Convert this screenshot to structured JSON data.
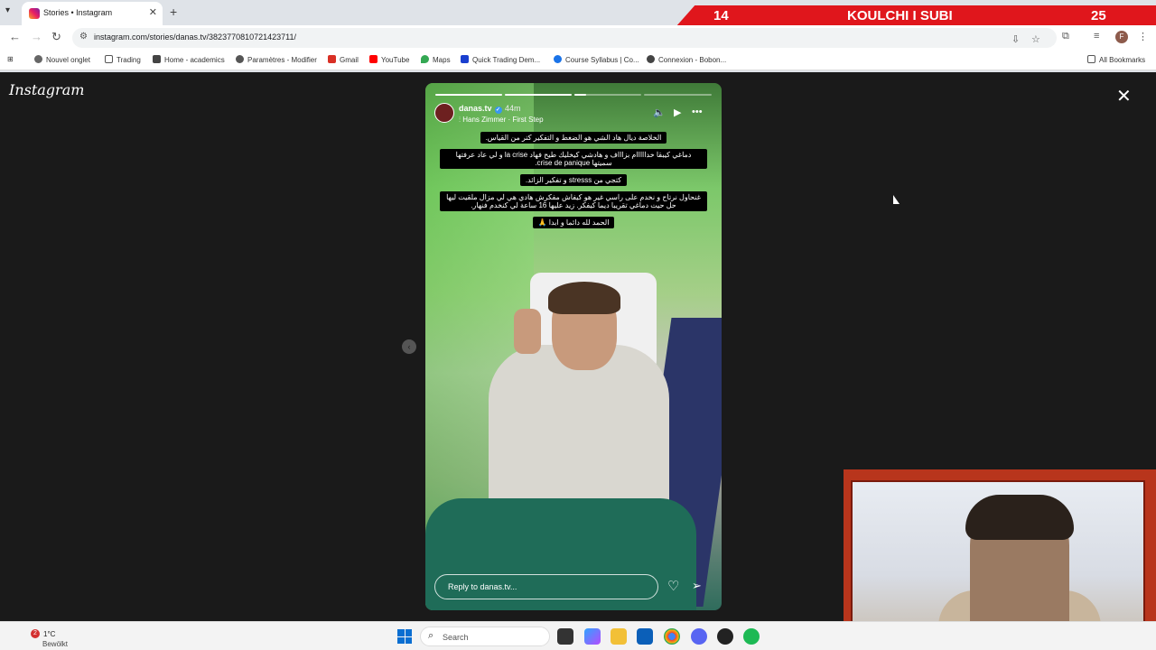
{
  "browser": {
    "tab_title": "Stories • Instagram",
    "tab_close": "✕",
    "new_tab": "+",
    "url": "instagram.com/stories/danas.tv/3823770810721423711/",
    "bookmarks": [
      {
        "label": "Nouvel onglet",
        "color": "#555"
      },
      {
        "label": "Trading",
        "color": "#777"
      },
      {
        "label": "Home - academics",
        "color": "#444"
      },
      {
        "label": "Paramètres - Modifier",
        "color": "#555"
      },
      {
        "label": "Gmail",
        "color": "#d93025"
      },
      {
        "label": "YouTube",
        "color": "#ff0000"
      },
      {
        "label": "Maps",
        "color": "#34a853"
      },
      {
        "label": "Quick Trading Dem...",
        "color": "#1a3fcf"
      },
      {
        "label": "Course Syllabus | Co...",
        "color": "#1a73e8"
      },
      {
        "label": "Connexion - Bobon...",
        "color": "#444"
      }
    ],
    "all_bookmarks": "All Bookmarks",
    "profile_initial": "F"
  },
  "overlay_banner": {
    "left_number": "14",
    "text": "KOULCHI I SUBI",
    "right_number": "25"
  },
  "instagram": {
    "logo": "Instagram",
    "close": "✕",
    "prev": "‹"
  },
  "story": {
    "username": "danas.tv",
    "verified": "✓",
    "time": "44m",
    "music": "Hans Zimmer · First Step",
    "captions": [
      "الخلاصة ديال هاد الشي هو الضغط و التفكير كتر من القياس.",
      "دماغي كيبقا خدااااام بزاااف و هادشي كيخليك طيح فهاد la crise و لي عاد عرفتها سميتها crise de panique.",
      "كتجي من stresss و تفكير الزائد.",
      "غنحاول نرتاح و نخدم على راسي غير هو كيفاش مفكرش هادي هي لي مزال ملقيت ليها حل حيت دماغي تقريبا ديما كيفكر. زيد عليها 16 ساعة لي كنخدم فنهار.",
      "الحمد لله دائما و ابدا 🙏"
    ],
    "reply_placeholder": "Reply to danas.tv...",
    "progress": [
      {
        "state": "done"
      },
      {
        "state": "done"
      },
      {
        "state": "partial"
      },
      {
        "state": "pending"
      }
    ]
  },
  "taskbar": {
    "weather_badge": "2",
    "temp": "1°C",
    "condition": "Bewölkt",
    "search_label": "Search"
  },
  "colors": {
    "banner_red": "#e0161c",
    "webcam_frame": "#b8351c",
    "instagram_blue": "#3897f0"
  }
}
